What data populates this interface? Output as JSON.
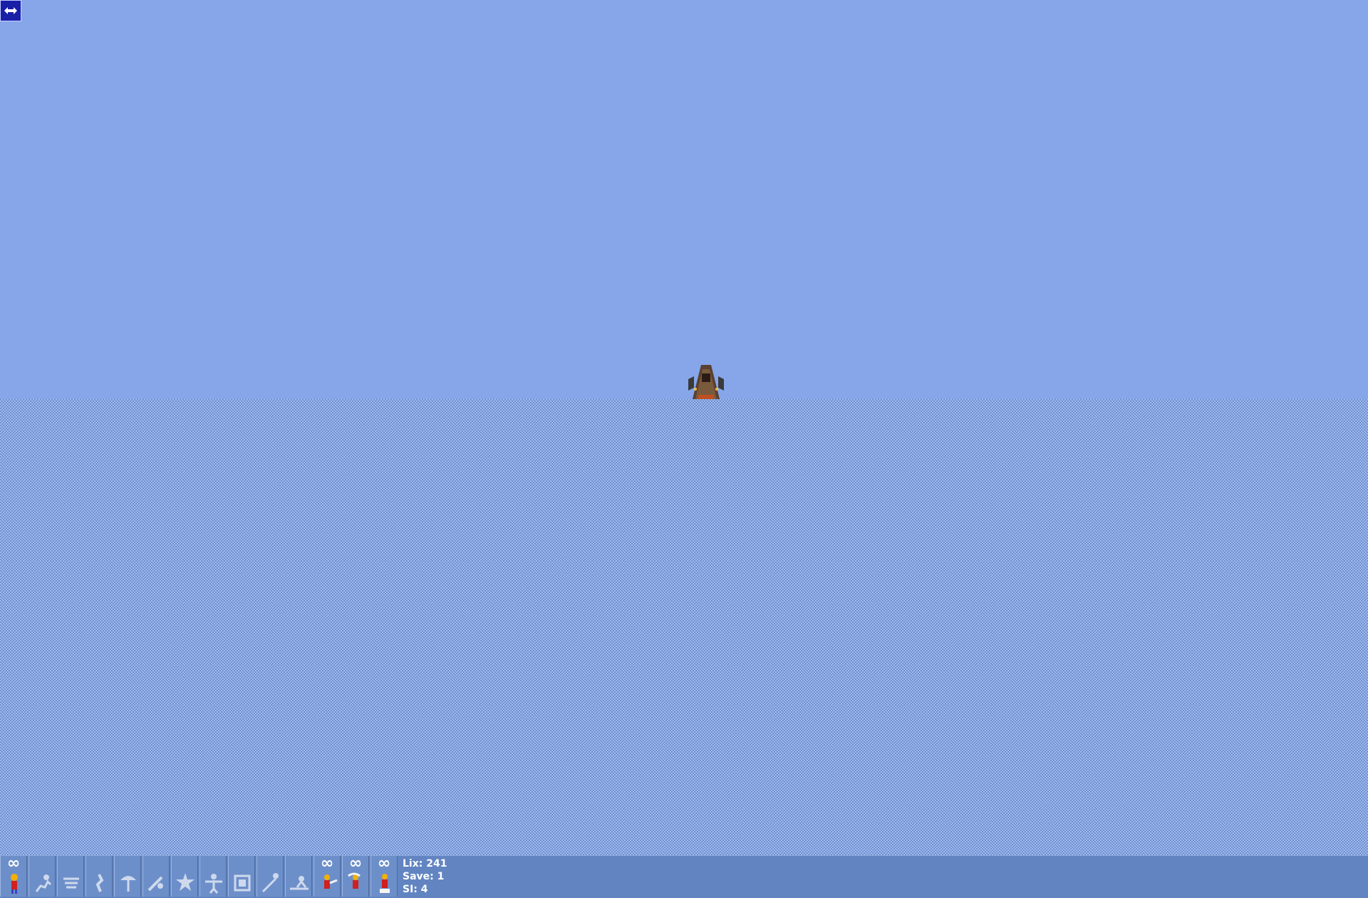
{
  "scroll_toggle": {
    "icon": "double-arrow-icon"
  },
  "hatch": {
    "icon": "entrance-hatch-icon"
  },
  "skills": [
    {
      "name": "walker",
      "count": "∞",
      "icon": "walker-icon",
      "active": true
    },
    {
      "name": "runner",
      "count": "",
      "icon": "runner-icon",
      "active": false
    },
    {
      "name": "jumper",
      "count": "",
      "icon": "jumper-icon",
      "active": false
    },
    {
      "name": "climber",
      "count": "",
      "icon": "climber-icon",
      "active": false
    },
    {
      "name": "floater",
      "count": "",
      "icon": "floater-icon",
      "active": false
    },
    {
      "name": "batter",
      "count": "",
      "icon": "batter-icon",
      "active": false
    },
    {
      "name": "exploder",
      "count": "",
      "icon": "exploder-icon",
      "active": false
    },
    {
      "name": "blocker",
      "count": "",
      "icon": "blocker-icon",
      "active": false
    },
    {
      "name": "cuber",
      "count": "",
      "icon": "cuber-icon",
      "active": false
    },
    {
      "name": "builder",
      "count": "",
      "icon": "builder-icon",
      "active": false
    },
    {
      "name": "platformer",
      "count": "",
      "icon": "platformer-icon",
      "active": false
    },
    {
      "name": "basher",
      "count": "∞",
      "icon": "basher-icon",
      "active": true
    },
    {
      "name": "miner",
      "count": "∞",
      "icon": "miner-icon",
      "active": true
    },
    {
      "name": "digger",
      "count": "∞",
      "icon": "digger-icon",
      "active": true
    }
  ],
  "stats": {
    "lix_label": "Lix:",
    "lix_value": "241",
    "save_label": "Save:",
    "save_value": "1",
    "si_label": "SI:",
    "si_value": "4"
  },
  "colors": {
    "sky": "#86a6e9",
    "terrain_dark": "#6f91cf",
    "terrain_light": "#9fb9ee",
    "panel": "#6285c2",
    "toggle": "#1820a8"
  }
}
